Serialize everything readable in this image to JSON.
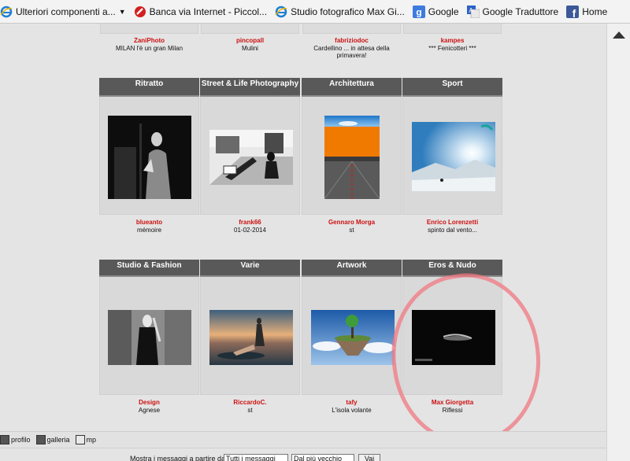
{
  "bookmarks": [
    {
      "label": "Ulteriori componenti a...",
      "icon": "ie-icon",
      "has_dropdown": true
    },
    {
      "label": "Banca via Internet - Piccol...",
      "icon": "no-entry-icon"
    },
    {
      "label": "Studio fotografico Max Gi...",
      "icon": "ie-icon"
    },
    {
      "label": "Google",
      "icon": "google-icon"
    },
    {
      "label": "Google Traduttore",
      "icon": "translate-icon"
    },
    {
      "label": "Home",
      "icon": "facebook-icon"
    }
  ],
  "top_row": [
    {
      "author": "ZaniPhoto",
      "desc": "MILAN l'è un gran Milan"
    },
    {
      "author": "pincopall",
      "desc": "Mulini"
    },
    {
      "author": "fabriziodoc",
      "desc": "Cardellino ... in attesa della primavera!"
    },
    {
      "author": "kampes",
      "desc": "*** Fenicotteri ***"
    }
  ],
  "categories": [
    {
      "title": "Ritratto",
      "author": "blueanto",
      "desc": "mémoire"
    },
    {
      "title": "Street & Life Photography",
      "author": "frank66",
      "desc": "01-02-2014"
    },
    {
      "title": "Architettura",
      "author": "Gennaro Morga",
      "desc": "st"
    },
    {
      "title": "Sport",
      "author": "Enrico Lorenzetti",
      "desc": "spinto dal vento..."
    },
    {
      "title": "Studio & Fashion",
      "author": "Design",
      "desc": "Agnese"
    },
    {
      "title": "Varie",
      "author": "RiccardoC.",
      "desc": "st"
    },
    {
      "title": "Artwork",
      "author": "tafy",
      "desc": "L'isola volante"
    },
    {
      "title": "Eros & Nudo",
      "author": "Max Giorgetta",
      "desc": "Riflessi"
    }
  ],
  "bottom_links": [
    {
      "label": "profilo",
      "icon": "profile-icon"
    },
    {
      "label": "galleria",
      "icon": "gallery-icon"
    },
    {
      "label": "mp",
      "icon": "mail-icon"
    }
  ],
  "filter": {
    "label": "Mostra i messaggi a partire da:",
    "select1": "Tutti i messaggi",
    "select2": "Dal più vecchio",
    "button": "Vai"
  },
  "colors": {
    "author_red": "#cc1111",
    "header_bg": "#595959",
    "annotation_circle": "#f07882"
  }
}
